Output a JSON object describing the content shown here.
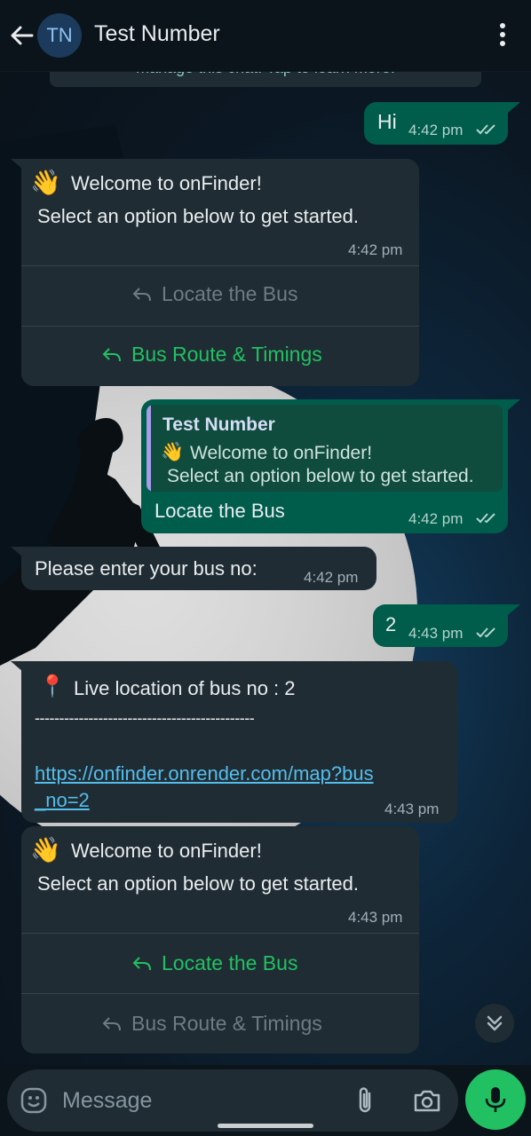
{
  "header": {
    "avatar_initials": "TN",
    "contact_name": "Test Number"
  },
  "system_note": "manage this chat. Tap to learn more.",
  "messages": {
    "m1": {
      "text": "Hi",
      "time": "4:42 pm",
      "status": "read"
    },
    "m2": {
      "emoji": "👋",
      "line1": "Welcome to onFinder!",
      "line2": "Select an option below to get started.",
      "time": "4:42 pm",
      "options": [
        {
          "label": "Locate the Bus",
          "state": "disabled"
        },
        {
          "label": "Bus Route & Timings",
          "state": "active"
        }
      ]
    },
    "m3": {
      "quote_author": "Test Number",
      "quote_emoji": "👋",
      "quote_line1": "Welcome to onFinder!",
      "quote_line2": "Select an option below to get started.",
      "text": "Locate the Bus",
      "time": "4:42 pm",
      "status": "read"
    },
    "m4": {
      "text": "Please enter your bus no:",
      "time": "4:42 pm"
    },
    "m5": {
      "text": "2",
      "time": "4:43 pm",
      "status": "read"
    },
    "m6": {
      "pin": "📍",
      "line1": "Live location of bus no : 2",
      "separator": "---------------------------------------------",
      "link_line1": "https://onfinder.onrender.com/map?bus",
      "link_line2": "_no=2",
      "time": "4:43 pm"
    },
    "m7": {
      "emoji": "👋",
      "line1": "Welcome to onFinder!",
      "line2": "Select an option below to get started.",
      "time": "4:43 pm",
      "options": [
        {
          "label": "Locate the Bus",
          "state": "active"
        },
        {
          "label": "Bus Route & Timings",
          "state": "disabled"
        }
      ]
    }
  },
  "composer": {
    "placeholder": "Message"
  },
  "colors": {
    "outgoing_bubble": "#005c4b",
    "incoming_bubble": "#202c33",
    "accent_green": "#21c063",
    "link_blue": "#53bdeb",
    "quote_bar": "#a79ce8"
  },
  "icons": [
    "back-arrow-icon",
    "more-vert-icon",
    "double-check-icon",
    "reply-icon",
    "chevrons-down-icon",
    "emoji-icon",
    "paperclip-icon",
    "camera-icon",
    "mic-icon"
  ]
}
